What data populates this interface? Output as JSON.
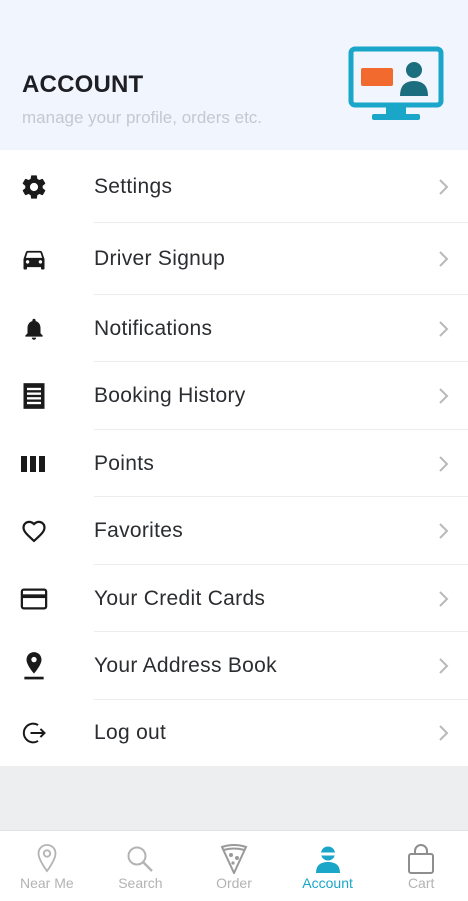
{
  "header": {
    "title": "ACCOUNT",
    "subtitle": "manage your profile, orders etc.",
    "illustration_icon": "monitor-profile-icon",
    "colors": {
      "accent": "#1aa6c9",
      "orange": "#f26a2e",
      "dark_teal": "#1b6e7d"
    }
  },
  "menu": {
    "items": [
      {
        "label": "Settings",
        "icon": "gear-icon"
      },
      {
        "label": "Driver Signup",
        "icon": "car-icon"
      },
      {
        "label": "Notifications",
        "icon": "bell-icon"
      },
      {
        "label": "Booking History",
        "icon": "receipt-icon"
      },
      {
        "label": "Points",
        "icon": "bars-icon"
      },
      {
        "label": "Favorites",
        "icon": "heart-icon"
      },
      {
        "label": "Your Credit Cards",
        "icon": "credit-card-icon"
      },
      {
        "label": "Your Address Book",
        "icon": "location-pin-icon"
      },
      {
        "label": "Log out",
        "icon": "logout-icon"
      }
    ]
  },
  "tabbar": {
    "active": "Account",
    "tabs": [
      {
        "label": "Near Me",
        "icon": "map-pin-icon"
      },
      {
        "label": "Search",
        "icon": "search-icon"
      },
      {
        "label": "Order",
        "icon": "pizza-icon"
      },
      {
        "label": "Account",
        "icon": "user-icon"
      },
      {
        "label": "Cart",
        "icon": "shopping-bag-icon"
      }
    ]
  }
}
